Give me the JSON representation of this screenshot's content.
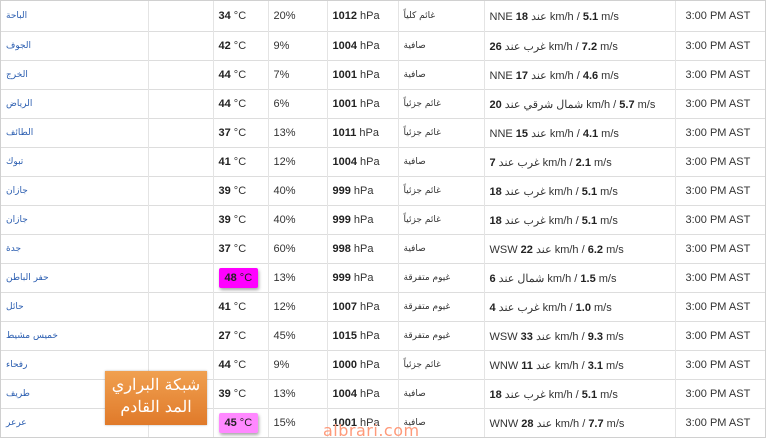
{
  "rows": [
    {
      "city": "الباحة",
      "temp": "34",
      "unit": " °C",
      "humidity": "20%",
      "pressure": "1012",
      "punit": " hPa",
      "condition": "غائم كلياً",
      "wind_pre": "NNE ",
      "wind_kmh": "18",
      "wind_mid": " عند km/h / ",
      "wind_ms": "5.1",
      "wind_post": " m/s",
      "time": "3:00 PM AST",
      "highlight": ""
    },
    {
      "city": "الجوف",
      "temp": "42",
      "unit": " °C",
      "humidity": "9%",
      "pressure": "1004",
      "punit": " hPa",
      "condition": "صافية",
      "wind_pre": "غرب عند ",
      "wind_kmh": "26",
      "wind_mid": " km/h / ",
      "wind_ms": "7.2",
      "wind_post": " m/s",
      "time": "3:00 PM AST",
      "highlight": ""
    },
    {
      "city": "الخرج",
      "temp": "44",
      "unit": " °C",
      "humidity": "7%",
      "pressure": "1001",
      "punit": " hPa",
      "condition": "صافية",
      "wind_pre": "NNE ",
      "wind_kmh": "17",
      "wind_mid": " عند km/h / ",
      "wind_ms": "4.6",
      "wind_post": " m/s",
      "time": "3:00 PM AST",
      "highlight": ""
    },
    {
      "city": "الرياض",
      "temp": "44",
      "unit": " °C",
      "humidity": "6%",
      "pressure": "1001",
      "punit": " hPa",
      "condition": "غائم جزئياً",
      "wind_pre": "شمال شرقي عند ",
      "wind_kmh": "20",
      "wind_mid": " km/h / ",
      "wind_ms": "5.7",
      "wind_post": " m/s",
      "time": "3:00 PM AST",
      "highlight": ""
    },
    {
      "city": "الطائف",
      "temp": "37",
      "unit": " °C",
      "humidity": "13%",
      "pressure": "1011",
      "punit": " hPa",
      "condition": "غائم جزئياً",
      "wind_pre": "NNE ",
      "wind_kmh": "15",
      "wind_mid": " عند km/h / ",
      "wind_ms": "4.1",
      "wind_post": " m/s",
      "time": "3:00 PM AST",
      "highlight": ""
    },
    {
      "city": "تبوك",
      "temp": "41",
      "unit": " °C",
      "humidity": "12%",
      "pressure": "1004",
      "punit": " hPa",
      "condition": "صافية",
      "wind_pre": "غرب عند ",
      "wind_kmh": "7",
      "wind_mid": " km/h / ",
      "wind_ms": "2.1",
      "wind_post": " m/s",
      "time": "3:00 PM AST",
      "highlight": ""
    },
    {
      "city": "جازان",
      "temp": "39",
      "unit": " °C",
      "humidity": "40%",
      "pressure": "999",
      "punit": " hPa",
      "condition": "غائم جزئياً",
      "wind_pre": "غرب عند ",
      "wind_kmh": "18",
      "wind_mid": " km/h / ",
      "wind_ms": "5.1",
      "wind_post": " m/s",
      "time": "3:00 PM AST",
      "highlight": ""
    },
    {
      "city": "جازان",
      "temp": "39",
      "unit": " °C",
      "humidity": "40%",
      "pressure": "999",
      "punit": " hPa",
      "condition": "غائم جزئياً",
      "wind_pre": "غرب عند ",
      "wind_kmh": "18",
      "wind_mid": " km/h / ",
      "wind_ms": "5.1",
      "wind_post": " m/s",
      "time": "3:00 PM AST",
      "highlight": ""
    },
    {
      "city": "جدة",
      "temp": "37",
      "unit": " °C",
      "humidity": "60%",
      "pressure": "998",
      "punit": " hPa",
      "condition": "صافية",
      "wind_pre": "WSW ",
      "wind_kmh": "22",
      "wind_mid": " عند km/h / ",
      "wind_ms": "6.2",
      "wind_post": " m/s",
      "time": "3:00 PM AST",
      "highlight": ""
    },
    {
      "city": "حفر الباطن",
      "temp": "48",
      "unit": " °C",
      "humidity": "13%",
      "pressure": "999",
      "punit": " hPa",
      "condition": "غيوم متفرقة",
      "wind_pre": "شمال عند ",
      "wind_kmh": "6",
      "wind_mid": " km/h / ",
      "wind_ms": "1.5",
      "wind_post": " m/s",
      "time": "3:00 PM AST",
      "highlight": "strong"
    },
    {
      "city": "حائل",
      "temp": "41",
      "unit": " °C",
      "humidity": "12%",
      "pressure": "1007",
      "punit": " hPa",
      "condition": "غيوم متفرقة",
      "wind_pre": "غرب عند ",
      "wind_kmh": "4",
      "wind_mid": " km/h / ",
      "wind_ms": "1.0",
      "wind_post": " m/s",
      "time": "3:00 PM AST",
      "highlight": ""
    },
    {
      "city": "خميس مشيط",
      "temp": "27",
      "unit": " °C",
      "humidity": "45%",
      "pressure": "1015",
      "punit": " hPa",
      "condition": "غيوم متفرقة",
      "wind_pre": "WSW ",
      "wind_kmh": "33",
      "wind_mid": " عند km/h / ",
      "wind_ms": "9.3",
      "wind_post": " m/s",
      "time": "3:00 PM AST",
      "highlight": ""
    },
    {
      "city": "رفحاء",
      "temp": "44",
      "unit": " °C",
      "humidity": "9%",
      "pressure": "1000",
      "punit": " hPa",
      "condition": "غائم جزئياً",
      "wind_pre": "WNW ",
      "wind_kmh": "11",
      "wind_mid": " عند km/h / ",
      "wind_ms": "3.1",
      "wind_post": " m/s",
      "time": "3:00 PM AST",
      "highlight": ""
    },
    {
      "city": "طريف",
      "temp": "39",
      "unit": " °C",
      "humidity": "13%",
      "pressure": "1004",
      "punit": " hPa",
      "condition": "صافية",
      "wind_pre": "غرب عند ",
      "wind_kmh": "18",
      "wind_mid": " km/h / ",
      "wind_ms": "5.1",
      "wind_post": " m/s",
      "time": "3:00 PM AST",
      "highlight": ""
    },
    {
      "city": "عرعر",
      "temp": "45",
      "unit": " °C",
      "humidity": "15%",
      "pressure": "1001",
      "punit": " hPa",
      "condition": "صافية",
      "wind_pre": "WNW ",
      "wind_kmh": "28",
      "wind_mid": " عند km/h / ",
      "wind_ms": "7.7",
      "wind_post": " m/s",
      "time": "3:00 PM AST",
      "highlight": "soft"
    }
  ],
  "watermark": {
    "line1": "شبكة البراري",
    "line2": "المد القادم",
    "url": "albrari.com"
  },
  "colors": {
    "city_link": "#2a5db0",
    "highlight_strong": "#ff00ff",
    "highlight_soft": "#ff88ff",
    "watermark_bg": "#e88838",
    "watermark_url": "#ff9a7a"
  }
}
